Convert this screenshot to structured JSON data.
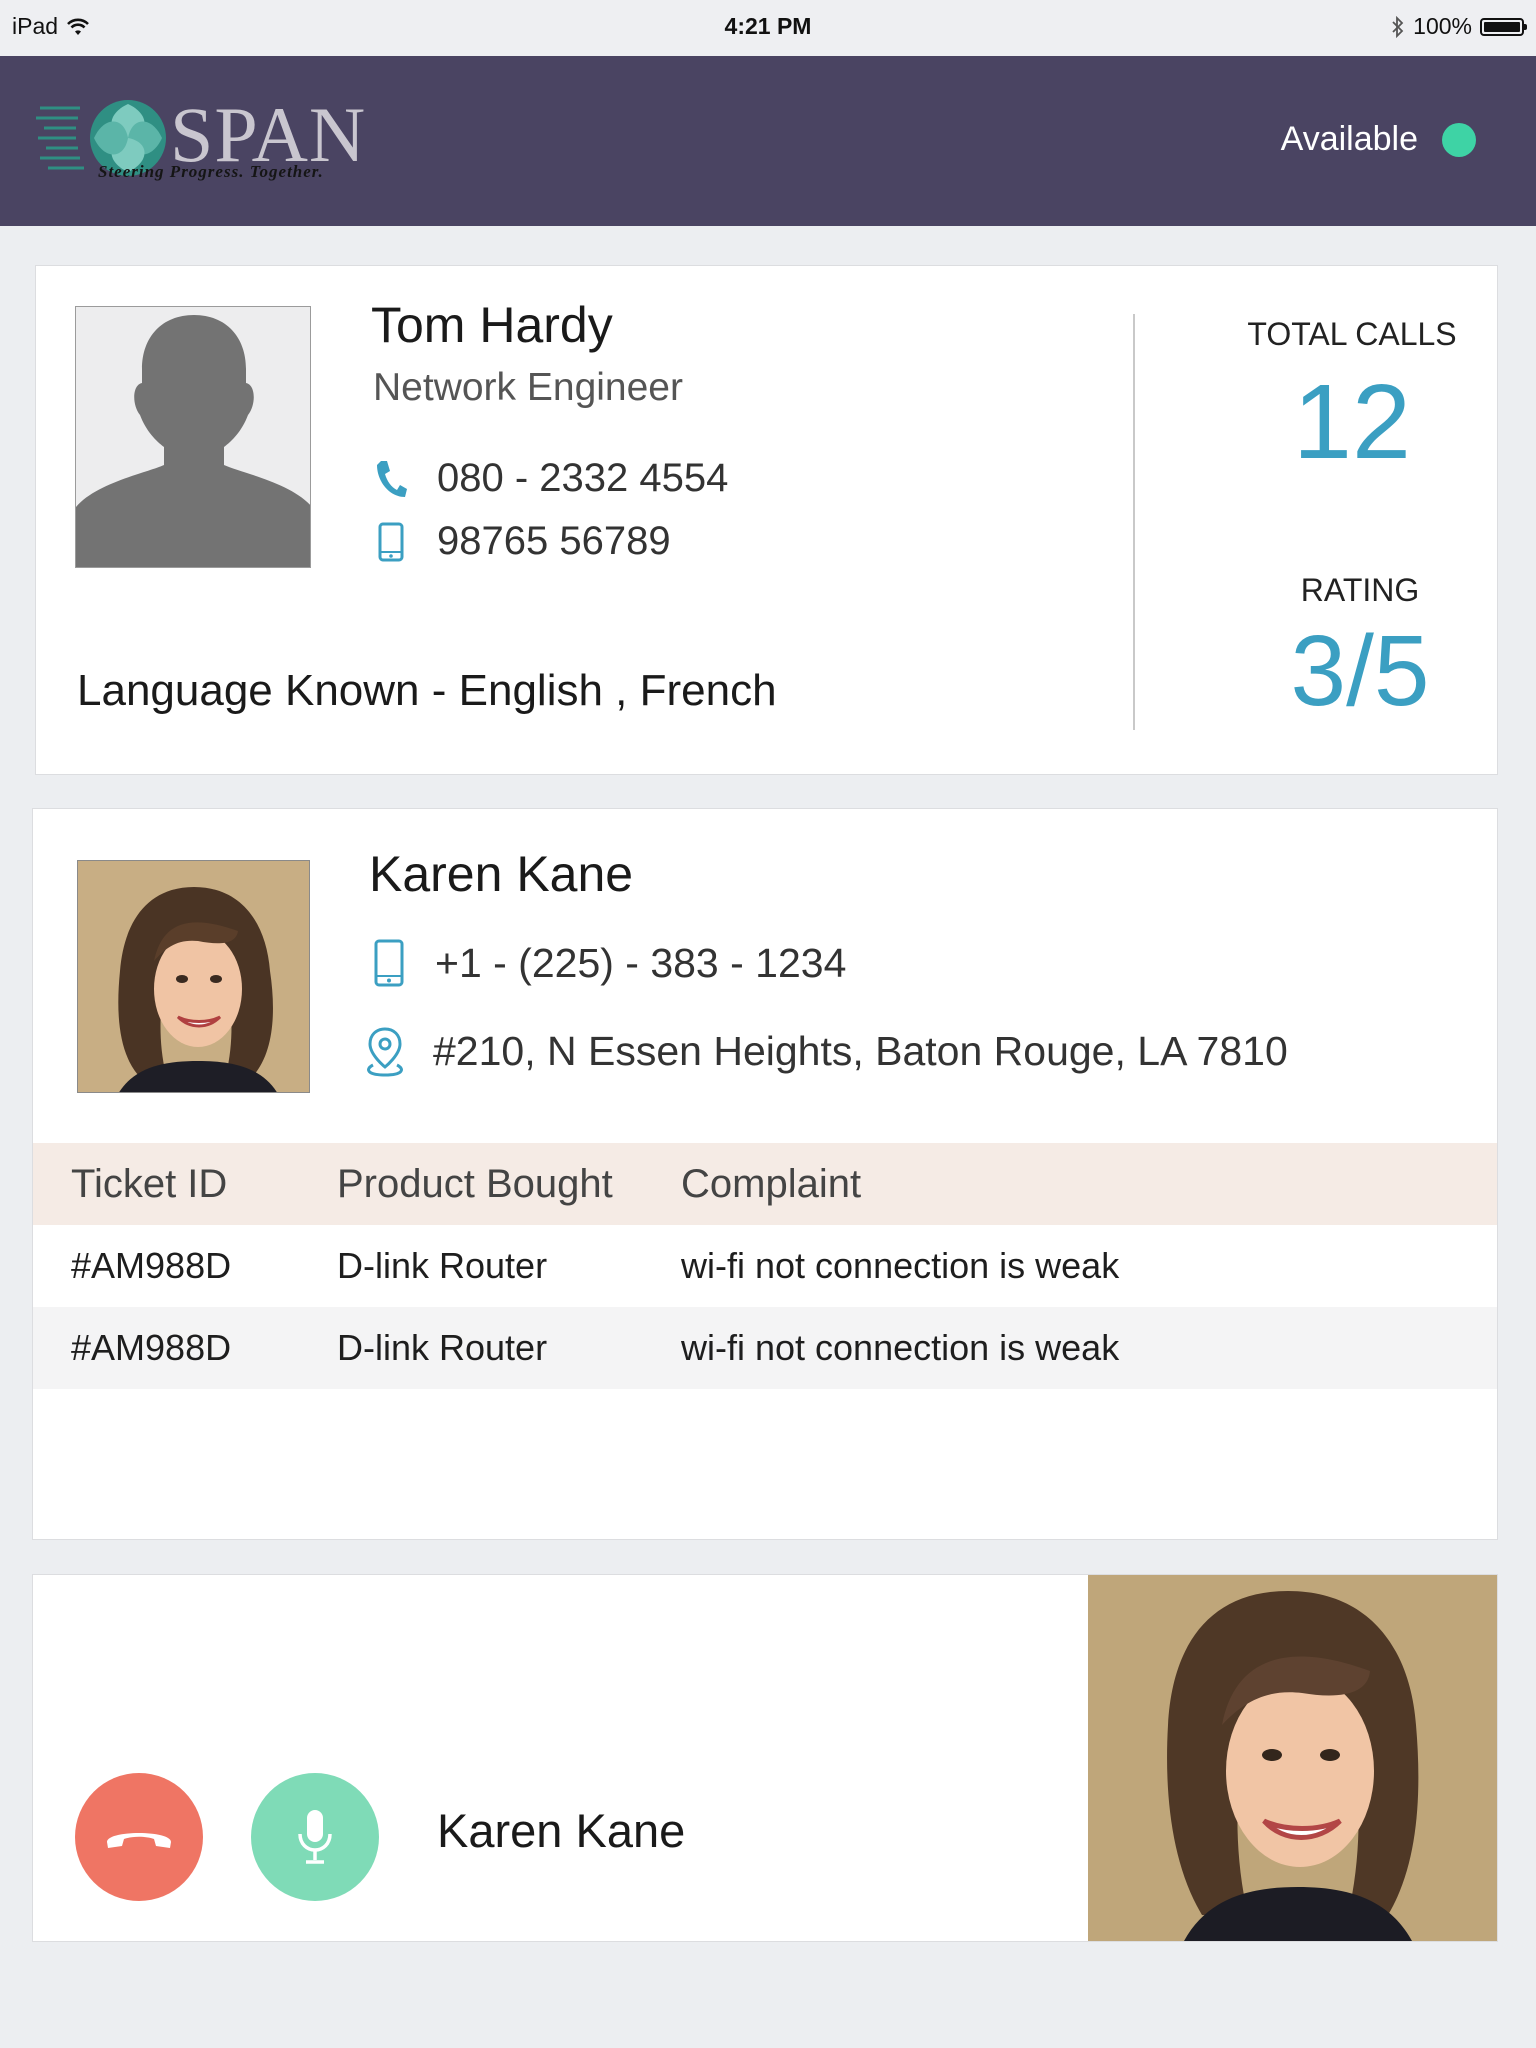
{
  "status_bar": {
    "device": "iPad",
    "time": "4:21 PM",
    "battery": "100%"
  },
  "header": {
    "logo_word": "SPAN",
    "logo_tagline": "Steering Progress. Together.",
    "availability": "Available",
    "availability_color": "#3ed3a5",
    "background_color": "#4a4462"
  },
  "agent": {
    "name": "Tom Hardy",
    "role": "Network Engineer",
    "phone": "080 - 2332 4554",
    "mobile": "98765 56789",
    "languages": "Language Known - English , French",
    "total_calls_label": "TOTAL CALLS",
    "total_calls": "12",
    "rating_label": "RATING",
    "rating": "3/5"
  },
  "customer": {
    "name": "Karen Kane",
    "phone": "+1 - (225) - 383 - 1234",
    "address": "#210, N Essen Heights, Baton Rouge, LA 7810"
  },
  "tickets": {
    "headers": [
      "Ticket ID",
      "Product Bought",
      "Complaint"
    ],
    "rows": [
      [
        "#AM988D",
        "D-link Router",
        "wi-fi not connection is weak"
      ],
      [
        "#AM988D",
        "D-link Router",
        "wi-fi not connection is weak"
      ]
    ]
  },
  "call": {
    "caller_name": "Karen Kane",
    "hangup_color": "#ef7564",
    "mic_color": "#7fdbb7"
  },
  "icons": {
    "phone": "phone-icon",
    "mobile": "mobile-icon",
    "location": "location-pin-icon",
    "hangup": "hangup-icon",
    "mic": "microphone-icon"
  },
  "accent_color": "#3b9fc2"
}
